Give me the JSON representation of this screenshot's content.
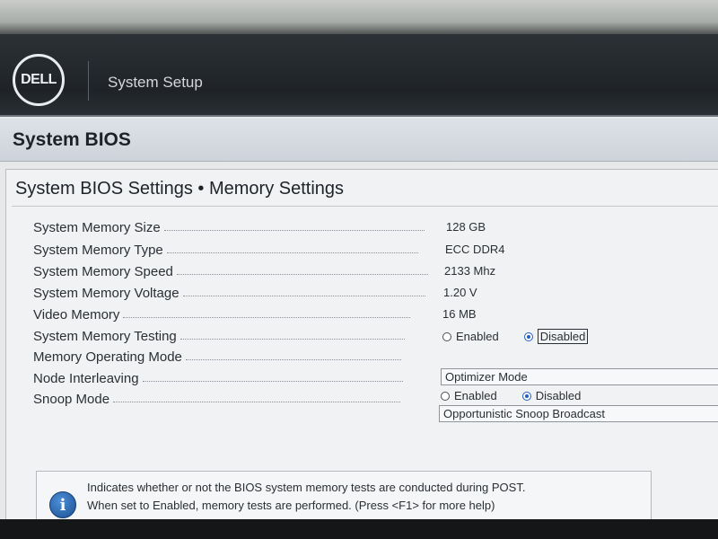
{
  "header": {
    "logo_text": "DELL",
    "title": "System Setup"
  },
  "section": {
    "title": "System BIOS"
  },
  "panel": {
    "title": "System BIOS Settings • Memory Settings"
  },
  "settings": [
    {
      "label": "System Memory Size",
      "value": "128 GB"
    },
    {
      "label": "System Memory Type",
      "value": "ECC DDR4"
    },
    {
      "label": "System Memory Speed",
      "value": "2133 Mhz"
    },
    {
      "label": "System Memory Voltage",
      "value": "1.20 V"
    },
    {
      "label": "Video Memory",
      "value": "16 MB"
    },
    {
      "label": "System Memory Testing",
      "options": [
        "Enabled",
        "Disabled"
      ],
      "selected": "Disabled"
    },
    {
      "label": "Memory Operating Mode",
      "value": "Optimizer Mode"
    },
    {
      "label": "Node Interleaving",
      "options": [
        "Enabled",
        "Disabled"
      ],
      "selected": "Disabled"
    },
    {
      "label": "Snoop Mode",
      "value": "Opportunistic Snoop Broadcast"
    }
  ],
  "help": {
    "icon": "info-icon",
    "line1": "Indicates whether or not the BIOS system memory tests are conducted during POST.",
    "line2": "When set to Enabled, memory tests are performed. (Press <F1> for more help)"
  },
  "colors": {
    "header_bg": "#1f2327",
    "radio_selected": "#1f5fbf",
    "info_icon": "#1a4f94"
  }
}
